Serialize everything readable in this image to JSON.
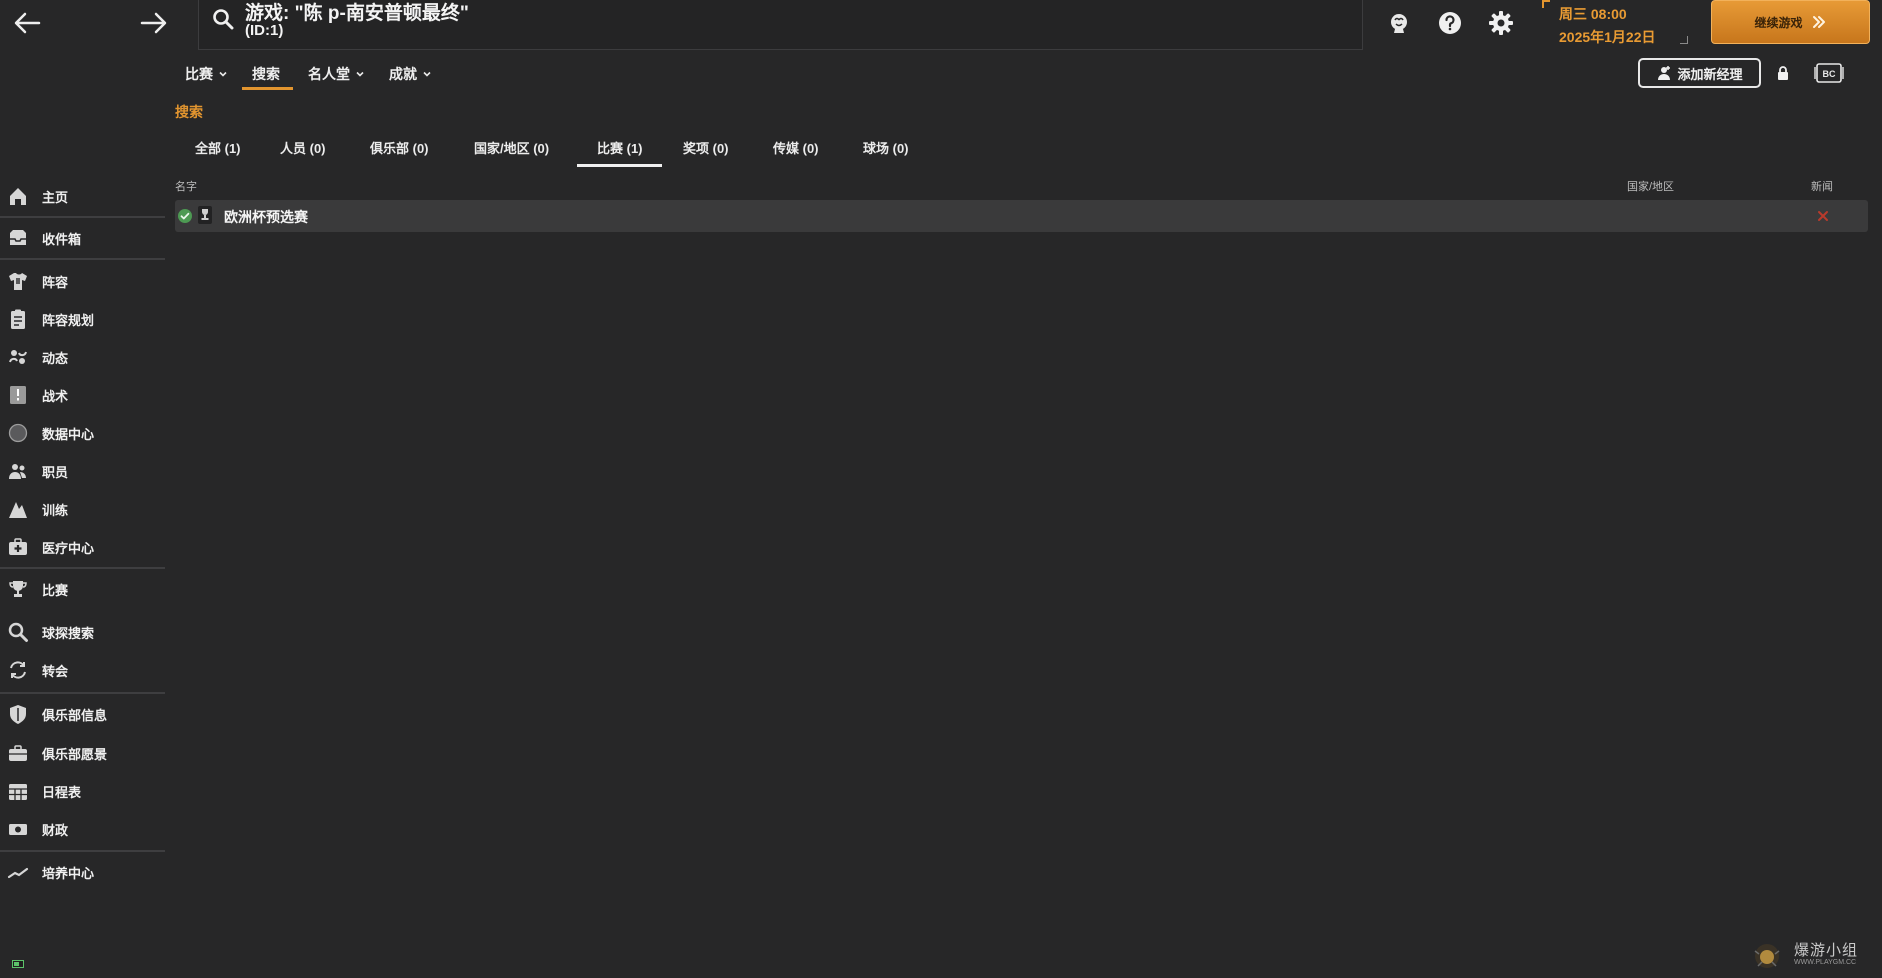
{
  "header": {
    "search_title": "游戏: \"陈 p-南安普顿最终\"",
    "search_subtitle": "(ID:1)",
    "date_line1": "周三 08:00",
    "date_line2": "2025年1月22日",
    "continue_label": "继续游戏",
    "add_manager_label": "添加新经理"
  },
  "menu": {
    "items": [
      {
        "label": "比赛",
        "has_dropdown": true
      },
      {
        "label": "搜索",
        "has_dropdown": false,
        "active": true
      },
      {
        "label": "名人堂",
        "has_dropdown": true
      },
      {
        "label": "成就",
        "has_dropdown": true
      }
    ]
  },
  "section": {
    "title": "搜索"
  },
  "tabs": [
    {
      "label": "全部 (1)"
    },
    {
      "label": "人员 (0)"
    },
    {
      "label": "俱乐部 (0)"
    },
    {
      "label": "国家/地区 (0)"
    },
    {
      "label": "比赛 (1)",
      "active": true
    },
    {
      "label": "奖项 (0)"
    },
    {
      "label": "传媒 (0)"
    },
    {
      "label": "球场 (0)"
    }
  ],
  "table": {
    "columns": [
      "名字",
      "国家/地区",
      "新闻"
    ],
    "rows": [
      {
        "name": "欧洲杯预选赛",
        "country": "",
        "news_icon": "red-x-icon"
      }
    ]
  },
  "sidebar": {
    "items": [
      {
        "label": "主页",
        "icon": "home-icon"
      },
      {
        "label": "收件箱",
        "icon": "inbox-icon"
      },
      {
        "label": "阵容",
        "icon": "shirt-icon"
      },
      {
        "label": "阵容规划",
        "icon": "clipboard-icon"
      },
      {
        "label": "动态",
        "icon": "dynamics-icon"
      },
      {
        "label": "战术",
        "icon": "tactics-icon"
      },
      {
        "label": "数据中心",
        "icon": "data-hub-icon"
      },
      {
        "label": "职员",
        "icon": "staff-icon"
      },
      {
        "label": "训练",
        "icon": "training-icon"
      },
      {
        "label": "医疗中心",
        "icon": "medical-icon"
      },
      {
        "label": "比赛",
        "icon": "trophy-icon"
      },
      {
        "label": "球探搜索",
        "icon": "scouting-icon"
      },
      {
        "label": "转会",
        "icon": "transfer-icon"
      },
      {
        "label": "俱乐部信息",
        "icon": "shield-icon"
      },
      {
        "label": "俱乐部愿景",
        "icon": "briefcase-icon"
      },
      {
        "label": "日程表",
        "icon": "calendar-icon"
      },
      {
        "label": "财政",
        "icon": "money-icon"
      },
      {
        "label": "培养中心",
        "icon": "development-icon"
      }
    ]
  },
  "watermark": {
    "text": "爆游小组",
    "url": "WWW.PLAYGM.CC"
  },
  "colors": {
    "background": "#272728",
    "accent": "#e2952f",
    "row_background": "#3a3a3b"
  }
}
